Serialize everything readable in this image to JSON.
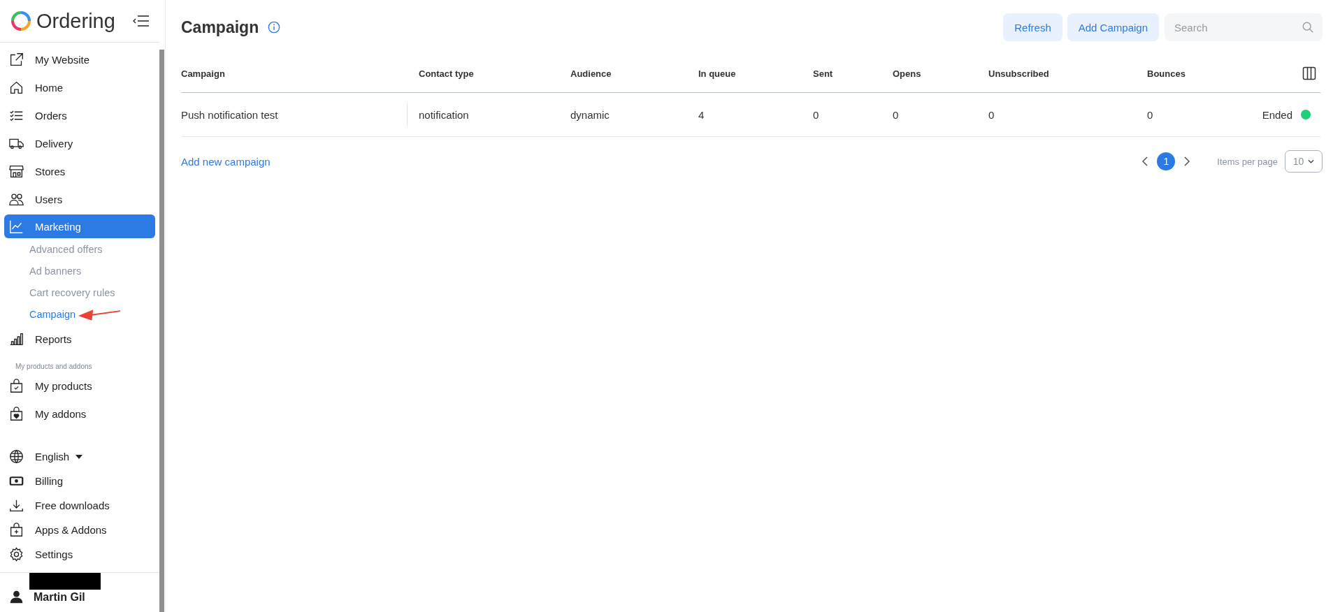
{
  "sidebar": {
    "brand": "Ordering",
    "nav": [
      {
        "label": "My Website",
        "kind": "external",
        "selected": false
      },
      {
        "label": "Home",
        "kind": "home",
        "selected": false
      },
      {
        "label": "Orders",
        "kind": "list",
        "selected": false
      },
      {
        "label": "Delivery",
        "kind": "truck",
        "selected": false
      },
      {
        "label": "Stores",
        "kind": "store",
        "selected": false
      },
      {
        "label": "Users",
        "kind": "users",
        "selected": false
      },
      {
        "label": "Marketing",
        "kind": "chart",
        "selected": true,
        "children": [
          {
            "label": "Advanced offers",
            "selected": false
          },
          {
            "label": "Ad banners",
            "selected": false
          },
          {
            "label": "Cart recovery rules",
            "selected": false
          },
          {
            "label": "Campaign",
            "selected": true
          }
        ]
      },
      {
        "label": "Reports",
        "kind": "bars",
        "selected": false
      }
    ],
    "section_label": "My products and addons",
    "products": [
      {
        "label": "My products",
        "kind": "bagcheck",
        "selected": false
      },
      {
        "label": "My addons",
        "kind": "bagheart",
        "selected": false
      }
    ],
    "bottom": [
      {
        "label": "English",
        "kind": "language"
      },
      {
        "label": "Billing",
        "kind": "billing"
      },
      {
        "label": "Free downloads",
        "kind": "downloads"
      },
      {
        "label": "Apps & Addons",
        "kind": "apps"
      },
      {
        "label": "Settings",
        "kind": "settings"
      }
    ],
    "user": "Martin Gil"
  },
  "header": {
    "title": "Campaign",
    "buttons": [
      "Refresh",
      "Add Campaign"
    ],
    "search": {
      "placeholder": "Search"
    }
  },
  "table": {
    "columns": [
      "Campaign",
      "Contact type",
      "Audience",
      "In queue",
      "Sent",
      "Opens",
      "Unsubscribed",
      "Bounces"
    ],
    "rows": [
      {
        "cells": [
          "Push notification test",
          "notification",
          "dynamic",
          "4",
          "0",
          "0",
          "0",
          "0"
        ],
        "status": "Ended",
        "color": "#1fcf7a"
      }
    ]
  },
  "add_link": "Add new campaign",
  "pagination": {
    "pages": [
      {
        "label": "1",
        "selected": true
      }
    ],
    "per_page_label": "Items per page",
    "per_page": "10"
  }
}
